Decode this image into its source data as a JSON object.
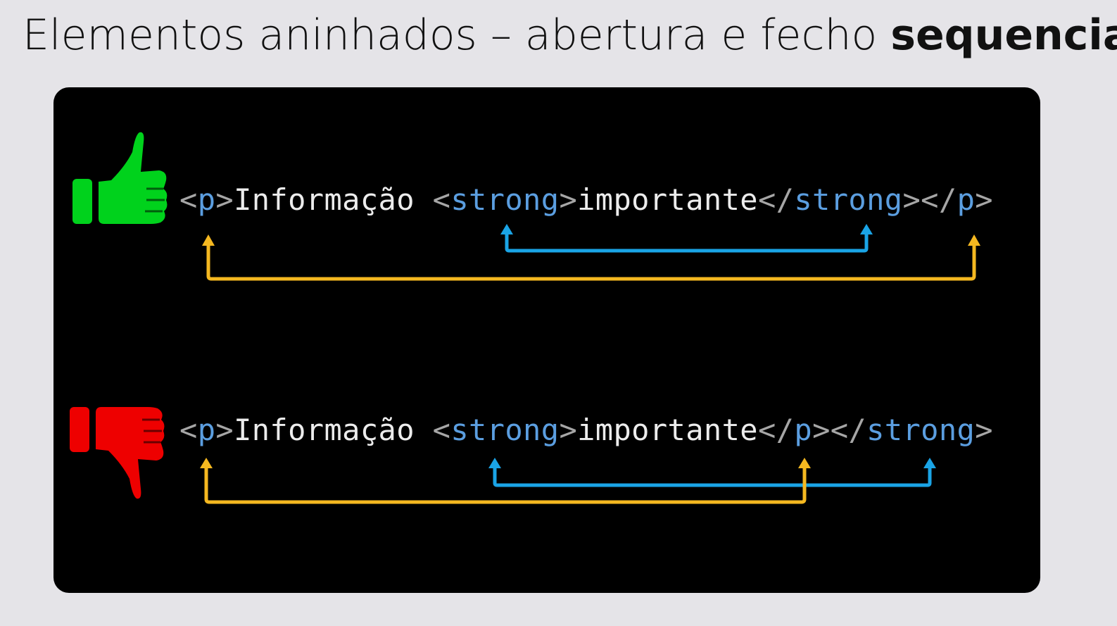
{
  "title": {
    "normal": "Elementos aninhados – abertura e fecho",
    "bold": "sequencial"
  },
  "colors": {
    "background": "#e5e4e8",
    "panel": "#000000",
    "good": "#00d21c",
    "bad": "#ee0000",
    "outer_bracket": "#f5b820",
    "inner_bracket": "#1aa4e6",
    "tag": "#5b9ee0",
    "punctuation": "#a6a6a6",
    "text": "#ececec"
  },
  "examples": [
    {
      "verdict": "correct",
      "icon": "thumbs-up-icon",
      "tokens": [
        {
          "t": "<",
          "k": "punct"
        },
        {
          "t": "p",
          "k": "tag"
        },
        {
          "t": ">",
          "k": "punct"
        },
        {
          "t": "Informação ",
          "k": "text"
        },
        {
          "t": "<",
          "k": "punct"
        },
        {
          "t": "strong",
          "k": "tag"
        },
        {
          "t": ">",
          "k": "punct"
        },
        {
          "t": "importante",
          "k": "text"
        },
        {
          "t": "</",
          "k": "punct"
        },
        {
          "t": "strong",
          "k": "tag"
        },
        {
          "t": "></",
          "k": "punct"
        },
        {
          "t": "p",
          "k": "tag"
        },
        {
          "t": ">",
          "k": "punct"
        }
      ]
    },
    {
      "verdict": "incorrect",
      "icon": "thumbs-down-icon",
      "tokens": [
        {
          "t": "<",
          "k": "punct"
        },
        {
          "t": "p",
          "k": "tag"
        },
        {
          "t": ">",
          "k": "punct"
        },
        {
          "t": "Informação ",
          "k": "text"
        },
        {
          "t": "<",
          "k": "punct"
        },
        {
          "t": "strong",
          "k": "tag"
        },
        {
          "t": ">",
          "k": "punct"
        },
        {
          "t": "importante",
          "k": "text"
        },
        {
          "t": "</",
          "k": "punct"
        },
        {
          "t": "p",
          "k": "tag"
        },
        {
          "t": "></",
          "k": "punct"
        },
        {
          "t": "strong",
          "k": "tag"
        },
        {
          "t": ">",
          "k": "punct"
        }
      ]
    }
  ]
}
